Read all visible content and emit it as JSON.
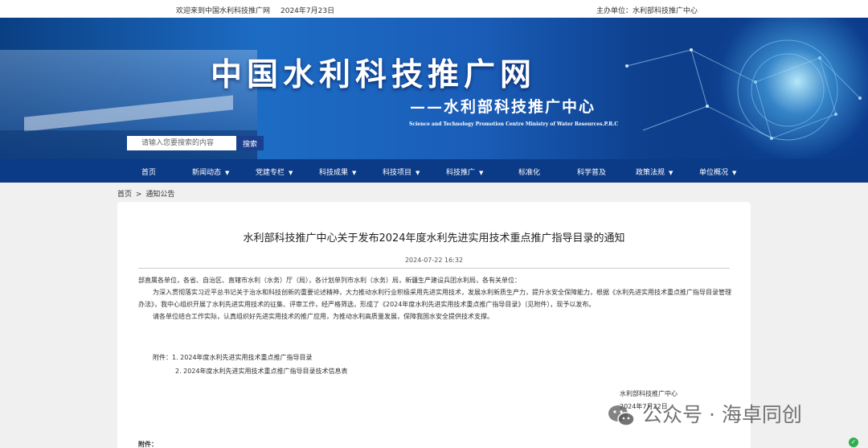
{
  "topbar": {
    "welcome": "欢迎来到中国水利科技推广网",
    "date": "2024年7月23日",
    "host": "主办单位：水利部科技推广中心"
  },
  "banner": {
    "title": "中国水利科技推广网",
    "subtitle": "——水利部科技推广中心",
    "english": "Science and Technology Promotion Centre Ministry of Water Resources.P.R.C",
    "search_placeholder": "请输入您要搜索的内容",
    "search_button": "搜索"
  },
  "nav": {
    "items": [
      {
        "label": "首页",
        "caret": ""
      },
      {
        "label": "新闻动态",
        "caret": "▼"
      },
      {
        "label": "党建专栏",
        "caret": "▼"
      },
      {
        "label": "科技成果",
        "caret": "▼"
      },
      {
        "label": "科技项目",
        "caret": "▼"
      },
      {
        "label": "科技推广",
        "caret": "▼"
      },
      {
        "label": "标准化",
        "caret": ""
      },
      {
        "label": "科学普及",
        "caret": ""
      },
      {
        "label": "政策法规",
        "caret": "▼"
      },
      {
        "label": "单位概况",
        "caret": "▼"
      }
    ]
  },
  "breadcrumb": {
    "home": "首页",
    "sep": ">",
    "current": "通知公告"
  },
  "article": {
    "title": "水利部科技推广中心关于发布2024年度水利先进实用技术重点推广指导目录的通知",
    "time": "2024-07-22 16:32",
    "salutation": "部直属各单位，各省、自治区、直辖市水利（水务）厅（局），各计划单列市水利（水务）局，新疆生产建设兵团水利局，各有关单位：",
    "para1": "为深入贯彻落实习近平总书记关于治水和科技创新的重要论述精神，大力推动水利行业积极采用先进实用技术，发展水利新质生产力，提升水安全保障能力，根据《水利先进实用技术重点推广指导目录管理办法》，我中心组织开展了水利先进实用技术的征集、评审工作，经严格筛选，形成了《2024年度水利先进实用技术重点推广指导目录》（见附件），现予以发布。",
    "para2": "请各单位结合工作实际，认真组织好先进实用技术的推广应用，为推动水利高质量发展，保障我国水安全提供技术支撑。",
    "attachment_1": "附件：1. 2024年度水利先进实用技术重点推广指导目录",
    "attachment_2": "2. 2024年度水利先进实用技术重点推广指导目录技术信息表",
    "sign_org": "水利部科技推广中心",
    "sign_date": "2024年7月22日",
    "footer_label": "附件："
  },
  "watermark": {
    "text": "公众号 · 海卓同创"
  }
}
